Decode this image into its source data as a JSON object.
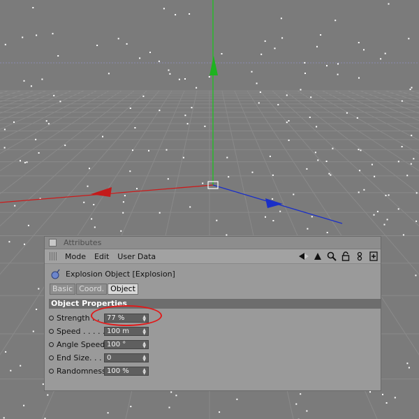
{
  "panel": {
    "title": "Attributes",
    "menu": [
      "Mode",
      "Edit",
      "User Data"
    ],
    "object_name": "Explosion Object [Explosion]",
    "tabs": [
      "Basic",
      "Coord.",
      "Object"
    ],
    "active_tab": "Object",
    "section_title": "Object Properties",
    "params": [
      {
        "label": "Strength . .",
        "value": "77 %"
      },
      {
        "label": "Speed . . . . . .",
        "value": "100 m"
      },
      {
        "label": "Angle Speed",
        "value": "100 °"
      },
      {
        "label": "End Size. . . .",
        "value": "0"
      },
      {
        "label": "Randomness",
        "value": "100 %"
      }
    ]
  },
  "icons": [
    "arrow-left-icon",
    "arrow-up-icon",
    "search-icon",
    "lock-icon",
    "link-icon",
    "new-panel-icon"
  ],
  "colors": {
    "viewport_bg": "#7b7b7b",
    "panel_bg": "#9a9a9a",
    "axis_x": "#cc1a1a",
    "axis_y": "#19c31c",
    "axis_z": "#1a2fc7",
    "highlight": "#e01a1a"
  }
}
